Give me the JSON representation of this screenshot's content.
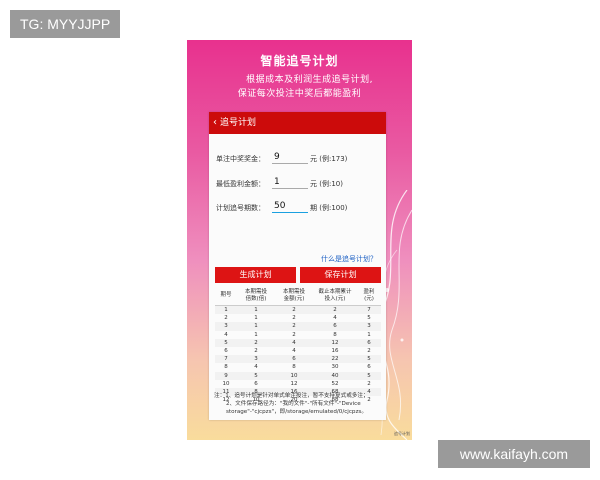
{
  "watermarks": {
    "top_left": "TG: MYYJJPP",
    "bottom_right": "www.kaifayh.com"
  },
  "banner": {
    "title": "智能追号计划",
    "line1": "根据成本及利润生成追号计划,",
    "line2": "保证每次投注中奖后都能盈利"
  },
  "titlebar": {
    "back_icon": "‹",
    "title": "追号计划"
  },
  "form": {
    "prize": {
      "label": "单注中奖奖金：",
      "value": "9",
      "unit": "元 (例:173)"
    },
    "min_profit": {
      "label": "最低盈利金额：",
      "value": "1",
      "unit": "元 (例:10)"
    },
    "periods": {
      "label": "计划追号期数：",
      "value": "50",
      "unit": "期 (例:100)"
    },
    "help_link": "什么是追号计划？"
  },
  "buttons": {
    "generate": "生成计划",
    "save": "保存计划"
  },
  "table": {
    "headers": [
      [
        "期号"
      ],
      [
        "本期需投",
        "倍数(倍)"
      ],
      [
        "本期需投",
        "金额(元)"
      ],
      [
        "截止本期累计",
        "投入(元)"
      ],
      [
        "盈利",
        "(元)"
      ]
    ],
    "rows": [
      [
        "1",
        "1",
        "2",
        "2",
        "7"
      ],
      [
        "2",
        "1",
        "2",
        "4",
        "5"
      ],
      [
        "3",
        "1",
        "2",
        "6",
        "3"
      ],
      [
        "4",
        "1",
        "2",
        "8",
        "1"
      ],
      [
        "5",
        "2",
        "4",
        "12",
        "6"
      ],
      [
        "6",
        "2",
        "4",
        "16",
        "2"
      ],
      [
        "7",
        "3",
        "6",
        "22",
        "5"
      ],
      [
        "8",
        "4",
        "8",
        "30",
        "6"
      ],
      [
        "9",
        "5",
        "10",
        "40",
        "5"
      ],
      [
        "10",
        "6",
        "12",
        "52",
        "2"
      ],
      [
        "11",
        "8",
        "16",
        "68",
        "4"
      ],
      [
        "12",
        "10",
        "20",
        "88",
        "2"
      ]
    ]
  },
  "notes": {
    "line1": "注：1、追号计划是针对单式单注投注，暂不支持复式或多注；",
    "line2": "2、文件保存路径为：\"我的文件\"-\"所有文件\"-\"Device storage\"-\"cjcpzs\"，即/storage/emulated/0/cjcpzs。"
  },
  "corner_label": "追号计划"
}
